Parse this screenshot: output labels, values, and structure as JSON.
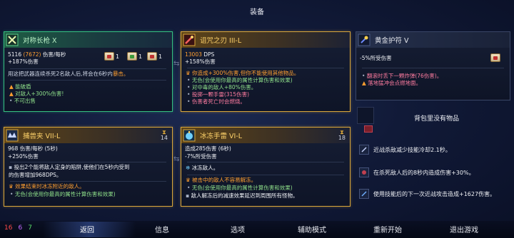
{
  "header": {
    "title": "装备"
  },
  "cards": {
    "spear": {
      "name": "对称长枪 X",
      "stat1": "5116",
      "stat1_alt": "(7672)",
      "stat1_label": "伤害/每秒",
      "stat2": "+187%伤害",
      "scroll1_count": "1",
      "scroll2_count": "1",
      "scroll3_count": "1",
      "desc_prefix": "用这把武器连续杀死2名敌人后,将会在6秒内",
      "desc_em": "暴击。",
      "tag1": "能破盾",
      "tag2": "对敌人+300%伤害!",
      "tag3": "不可出售"
    },
    "cursed": {
      "name": "诅咒之刃 III-L",
      "stat1": "13003",
      "stat1_label": "DPS",
      "stat2": "+158%伤害",
      "line1": "你造成+300%伤害,但你不能使用其他物品。",
      "line2": "无色(会使用你最高的属性计算伤害和效果)",
      "line3": "对中毒的敌人+80%伤害。",
      "line4": "投掷一颗手雷(315伤害)",
      "line5": "伤害者死亡时会燃烧。"
    },
    "amulet": {
      "name": "黄金护符 V",
      "stat1": "-5%所受伤害",
      "line1": "翻滚时丢下一颗炸弹(76伤害)。",
      "line2": "落地猛冲会点燃地面。"
    },
    "trap": {
      "name": "捕兽夹 VII-L",
      "level_label": "14",
      "stat1": "968",
      "stat1_label": "伤害/每秒 (5秒)",
      "stat2": "+250%伤害",
      "line1": "投出2个能将敌人定身的陷阱,使他们在5秒内受到",
      "line2": "的伤害增加968DPS。",
      "line3": "效果结束时冰冻附近的敌人。",
      "line4": "无色(会使用你最高的属性计算伤害和效果)"
    },
    "grenade": {
      "name": "冰冻手雷 VI-L",
      "level_label": "18",
      "stat1": "造成285伤害 (6秒)",
      "stat2": "-7%所受伤害",
      "line1": "冰冻敌人。",
      "line2": "被击中的敌人不容易解冻。",
      "line3": "无色(会使用你最高的属性计算伤害和效果)",
      "line4": "敌人解冻后的减速效果延迟到周围所有怪物。"
    },
    "backpack": {
      "empty_text": "背包里没有物品"
    }
  },
  "mutations": [
    {
      "text": "近战杀敌减少技能冷却2.1秒。"
    },
    {
      "text": "在杀死敌人后的8秒内造成伤害+30%。"
    },
    {
      "text": "使用技能后的下一次近战攻击造成+1627伤害。"
    }
  ],
  "currency": {
    "red": "16",
    "purple": "6",
    "green": "7"
  },
  "menu": {
    "back": "返回",
    "info": "信息",
    "options": "选项",
    "assist": "辅助模式",
    "restart": "重新开始",
    "quit": "退出游戏"
  },
  "colors": {
    "green_border": "#35c080",
    "gold_border": "#d9a63a",
    "accent_orange": "#ff9f30",
    "accent_green": "#8fe08a"
  }
}
